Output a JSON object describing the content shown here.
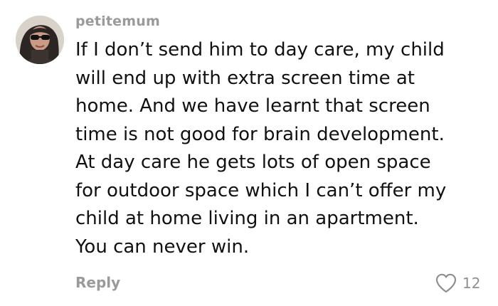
{
  "comment": {
    "username": "petitemum",
    "text_lines": [
      "If I don’t send him to day care, my child",
      "will end up with extra screen time at",
      "home. And we have learnt that screen",
      "time is not good for brain development.",
      "At day care he gets lots of open space",
      "for outdoor space which I can’t offer my",
      "child at home living in an apartment.",
      "You can never win."
    ],
    "reply_label": "Reply",
    "like_count": "12",
    "avatar_icon": "user-avatar-photo",
    "like_icon": "heart-outline-icon"
  }
}
